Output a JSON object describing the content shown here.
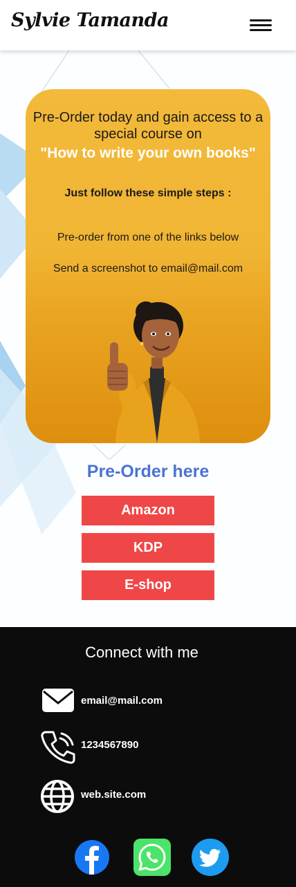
{
  "header": {
    "brand": "Sylvie Tamanda",
    "menu_icon": "hamburger-menu-icon"
  },
  "promo": {
    "headline": "Pre-Order today and gain access  to a special course on",
    "course_title": "\"How to write your own books\"",
    "steps_title": "Just follow these simple steps :",
    "steps": [
      "Pre-order from one of the links below",
      "Send a screenshot to email@mail.com"
    ],
    "illustration": "woman-thumbs-up-illustration"
  },
  "preorder": {
    "title": "Pre-Order here",
    "buttons": [
      "Amazon",
      "KDP",
      "E-shop"
    ],
    "button_color": "#ef4747",
    "title_color": "#4b73d3"
  },
  "footer": {
    "title": "Connect with me",
    "contacts": [
      {
        "icon": "envelope-icon",
        "text": "email@mail.com"
      },
      {
        "icon": "phone-icon",
        "text": "1234567890"
      },
      {
        "icon": "globe-icon",
        "text": "web.site.com"
      }
    ],
    "social": [
      {
        "icon": "facebook-icon",
        "color": "#1877f2"
      },
      {
        "icon": "whatsapp-icon",
        "color": "#4ce36a"
      },
      {
        "icon": "twitter-icon",
        "color": "#1d9bf0"
      }
    ]
  }
}
